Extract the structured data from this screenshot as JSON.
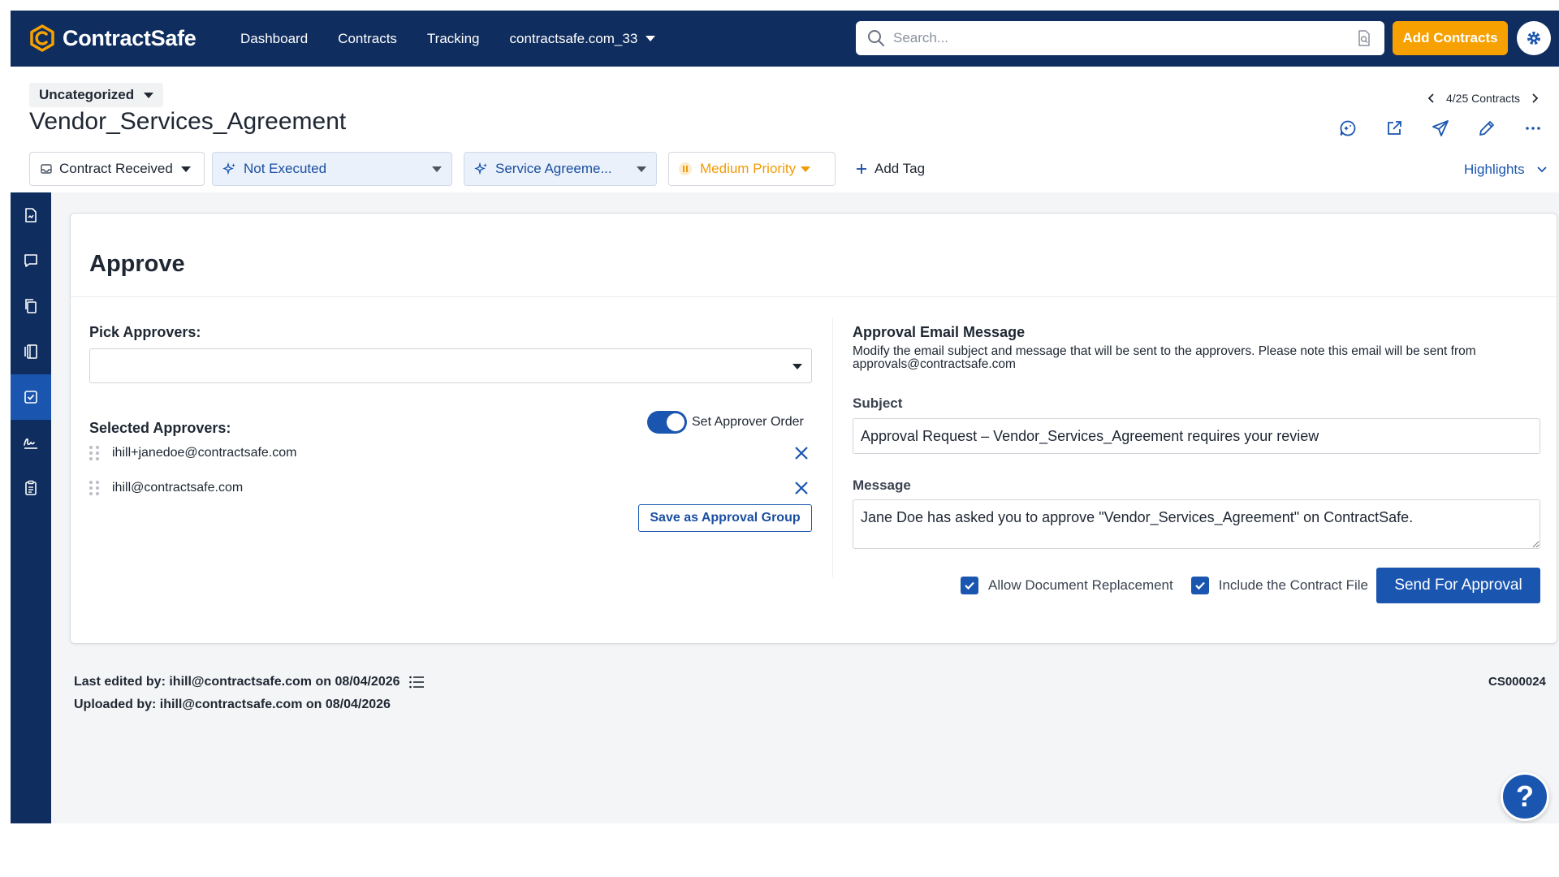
{
  "app": {
    "name": "ContractSafe"
  },
  "nav": {
    "links": [
      "Dashboard",
      "Contracts",
      "Tracking"
    ],
    "account": "contractsafe.com_33",
    "search_placeholder": "Search...",
    "add_contracts": "Add Contracts"
  },
  "header": {
    "category": "Uncategorized",
    "title": "Vendor_Services_Agreement",
    "pager": "4/25 Contracts",
    "highlights": "Highlights"
  },
  "status": {
    "stage": "Contract Received",
    "execution": "Not Executed",
    "type": "Service Agreeme...",
    "priority": "Medium Priority",
    "add_tag": "Add Tag"
  },
  "approve": {
    "title": "Approve",
    "pick_label": "Pick Approvers:",
    "selected_label": "Selected Approvers:",
    "order_label": "Set Approver Order",
    "approvers": [
      "ihill+janedoe@contractsafe.com",
      "ihill@contractsafe.com"
    ],
    "save_group": "Save as Approval Group",
    "email_title": "Approval Email Message",
    "email_desc": "Modify the email subject and message that will be sent to the approvers. Please note this email will be sent from approvals@contractsafe.com",
    "subject_label": "Subject",
    "subject_value": "Approval Request – Vendor_Services_Agreement requires your review",
    "message_label": "Message",
    "message_value": "Jane Doe has asked you to approve \"Vendor_Services_Agreement\" on ContractSafe.",
    "allow_replacement": "Allow Document Replacement",
    "include_file": "Include the Contract File",
    "send": "Send For Approval"
  },
  "footer": {
    "last_edited": "Last edited by: ihill@contractsafe.com on 08/04/2026",
    "uploaded": "Uploaded by: ihill@contractsafe.com on 08/04/2026",
    "contract_id": "CS000024",
    "help": "?"
  },
  "colors": {
    "nav_bg": "#0f2d5e",
    "accent": "#1a56b0",
    "orange": "#f7a100",
    "priority": "#f19c06"
  },
  "icons": {
    "sidebar": [
      "document-icon",
      "comment-icon",
      "copy-icon",
      "versions-icon",
      "approve-icon",
      "signature-icon",
      "checklist-icon"
    ],
    "header": [
      "ai-chat-icon",
      "open-external-icon",
      "send-icon",
      "edit-icon",
      "more-icon"
    ]
  }
}
